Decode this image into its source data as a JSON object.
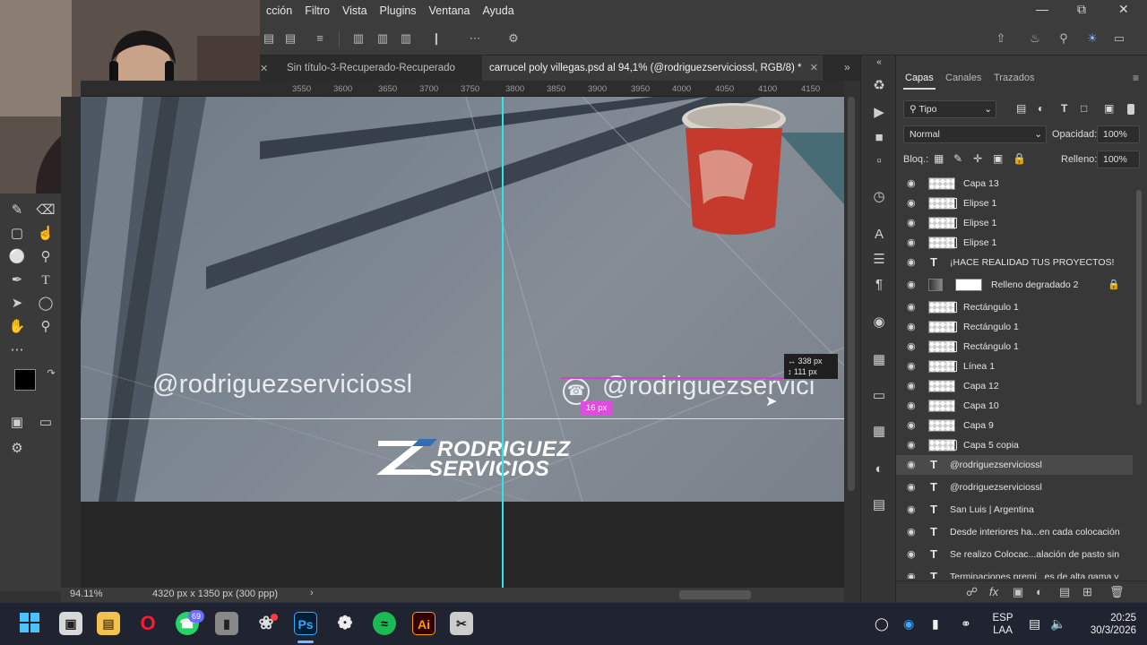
{
  "menubar": {
    "items": [
      "cción",
      "Filtro",
      "Vista",
      "Plugins",
      "Ventana",
      "Ayuda"
    ],
    "minimize_icon": "minimize-icon",
    "restore_icon": "restore-icon",
    "close_icon": "close-icon"
  },
  "doc_tabs": [
    {
      "label": "Sin título-3-Recuperado-Recuperado",
      "active": false
    },
    {
      "label": "carrucel poly villegas.psd al 94,1% (@rodriguezserviciossl, RGB/8) *",
      "active": true
    }
  ],
  "ruler": {
    "ticks": [
      "3550",
      "3600",
      "3650",
      "3700",
      "3750",
      "3800",
      "3850",
      "3900",
      "3950",
      "4000",
      "4050",
      "4100",
      "4150"
    ]
  },
  "canvas": {
    "handle_left": "@rodriguezserviciossl",
    "handle_right": "@rodriguezservici",
    "logo_line1": "RODRIGUEZ",
    "logo_line2": "SERVICIOS",
    "measure_badge": "16 px",
    "size_tip_w": "338 px",
    "size_tip_h": "111 px"
  },
  "status": {
    "zoom": "94.11%",
    "doc_info": "4320 px x 1350 px (300 ppp)"
  },
  "layers_panel": {
    "tabs": [
      "Capas",
      "Canales",
      "Trazados"
    ],
    "filter_label": "Tipo",
    "blend_mode": "Normal",
    "opacity_label": "Opacidad:",
    "opacity_value": "100%",
    "lock_label": "Bloq.:",
    "fill_label": "Relleno:",
    "fill_value": "100%",
    "layers": [
      {
        "name": "Capa 13",
        "kind": "pixel"
      },
      {
        "name": "Elipse 1",
        "kind": "shape"
      },
      {
        "name": "Elipse 1",
        "kind": "shape"
      },
      {
        "name": "Elipse 1",
        "kind": "shape"
      },
      {
        "name": "¡HACE REALIDAD TUS PROYECTOS!",
        "kind": "text"
      },
      {
        "name": "Relleno degradado 2",
        "kind": "gradient"
      },
      {
        "name": "Rectángulo 1",
        "kind": "shape"
      },
      {
        "name": "Rectángulo 1",
        "kind": "shape"
      },
      {
        "name": "Rectángulo 1",
        "kind": "shape"
      },
      {
        "name": "Línea 1",
        "kind": "shape"
      },
      {
        "name": "Capa 12",
        "kind": "pixel"
      },
      {
        "name": "Capa 10",
        "kind": "pixel"
      },
      {
        "name": "Capa 9",
        "kind": "pixel"
      },
      {
        "name": "Capa 5 copia",
        "kind": "smart"
      },
      {
        "name": "@rodriguezserviciossl",
        "kind": "text",
        "selected": true
      },
      {
        "name": "@rodriguezserviciossl",
        "kind": "text"
      },
      {
        "name": "San Luis | Argentina",
        "kind": "text"
      },
      {
        "name": "Desde interiores ha...en cada colocación",
        "kind": "text"
      },
      {
        "name": "Se realizo  Colocac...alación de pasto sin",
        "kind": "text"
      },
      {
        "name": "Terminaciones premi...es de alta gama y",
        "kind": "text"
      }
    ]
  },
  "taskbar": {
    "lang_line1": "ESP",
    "lang_line2": "LAA",
    "time": "20:25",
    "date": "30/3/2026",
    "whatsapp_badge": "69",
    "ps_label": "Ps",
    "ai_label": "Ai"
  },
  "colors": {
    "accent_cyan_guide": "#2ee6e6",
    "magenta_measure": "#e04ce0",
    "panel_bg": "#383838"
  }
}
